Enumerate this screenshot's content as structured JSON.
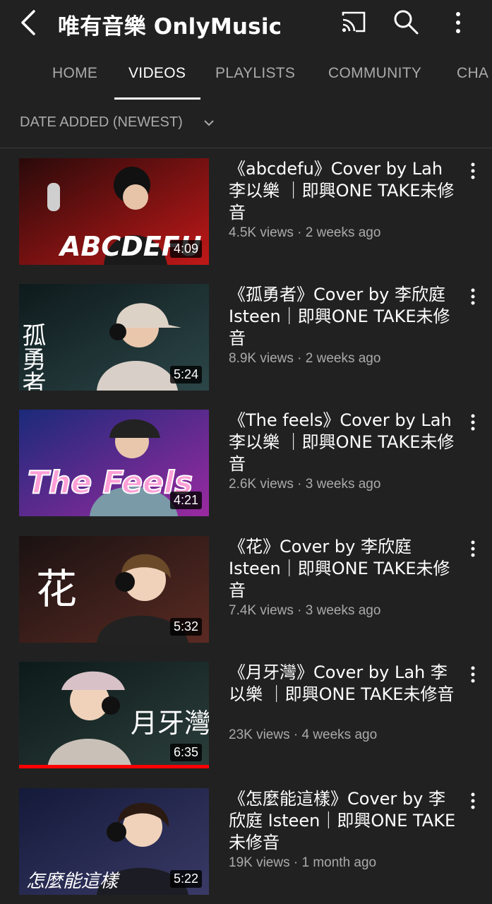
{
  "header": {
    "title": "唯有音樂 OnlyMusic"
  },
  "tabs": [
    {
      "label": "HOME"
    },
    {
      "label": "VIDEOS"
    },
    {
      "label": "PLAYLISTS"
    },
    {
      "label": "COMMUNITY"
    },
    {
      "label": "CHA"
    }
  ],
  "sort": {
    "label": "DATE ADDED (NEWEST)"
  },
  "videos": [
    {
      "title": "《abcdefu》Cover by Lah 李以樂 ｜即興ONE TAKE未修音",
      "meta": "4.5K views · 2 weeks ago",
      "duration": "4:09",
      "overlay_text": "ABCDEFU",
      "colors": [
        "#2a0a0a",
        "#c01818"
      ]
    },
    {
      "title": "《孤勇者》Cover by 李欣庭 Isteen｜即興ONE TAKE未修音",
      "meta": "8.9K views · 2 weeks ago",
      "duration": "5:24",
      "overlay_text": "孤勇者",
      "colors": [
        "#0e1a1c",
        "#2c4648"
      ]
    },
    {
      "title": "《The feels》Cover by Lah 李以樂 ｜即興ONE TAKE未修音",
      "meta": "2.6K views · 3 weeks ago",
      "duration": "4:21",
      "overlay_text": "The Feels",
      "colors": [
        "#1b2a7a",
        "#9a2aa0"
      ]
    },
    {
      "title": "《花》Cover by 李欣庭 Isteen｜即興ONE TAKE未修音",
      "meta": "7.4K views · 3 weeks ago",
      "duration": "5:32",
      "overlay_text": "花",
      "colors": [
        "#1a1212",
        "#5a2a22"
      ]
    },
    {
      "title": "《月牙灣》Cover by Lah 李以樂 ｜即興ONE TAKE未修音",
      "meta": "23K views · 4 weeks ago",
      "duration": "6:35",
      "overlay_text": "月牙灣",
      "colors": [
        "#0d1a1a",
        "#2b3e3a"
      ],
      "watched_fraction": 1.0
    },
    {
      "title": "《怎麼能這樣》Cover by 李欣庭 Isteen｜即興ONE TAKE未修音",
      "meta": "19K views · 1 month ago",
      "duration": "5:22",
      "overlay_text": "怎麼能這樣",
      "colors": [
        "#141a3a",
        "#3a3a66"
      ]
    }
  ]
}
